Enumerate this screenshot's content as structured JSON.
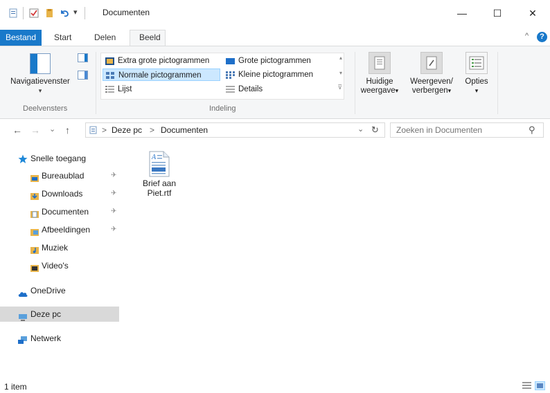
{
  "window": {
    "title": "Documenten",
    "minimize_glyph": "—",
    "maximize_glyph": "☐",
    "close_glyph": "✕",
    "qat_dropdown_glyph": "▾"
  },
  "ribbon": {
    "tabs": [
      "Bestand",
      "Start",
      "Delen",
      "Beeld"
    ],
    "active_tab": "Beeld",
    "collapse_glyph": "^",
    "help_glyph": "?",
    "panes_group": {
      "navigation_pane_label": "Navigatievenster",
      "group_label": "Deelvensters"
    },
    "layout_group": {
      "items": [
        "Extra grote pictogrammen",
        "Grote pictogrammen",
        "Normale pictogrammen",
        "Kleine pictogrammen",
        "Lijst",
        "Details"
      ],
      "selected": "Normale pictogrammen",
      "group_label": "Indeling"
    },
    "current_view": {
      "line1": "Huidige",
      "line2": "weergave"
    },
    "show_hide": {
      "line1": "Weergeven/",
      "line2": "verbergen"
    },
    "options": {
      "label": "Opties"
    },
    "dropdown_glyph": "▾"
  },
  "address": {
    "back_glyph": "←",
    "forward_glyph": "→",
    "recent_glyph": "⌄",
    "up_glyph": "↑",
    "separator_glyph": ">",
    "breadcrumbs": [
      "Deze pc",
      "Documenten"
    ],
    "dropdown_glyph": "⌄",
    "refresh_glyph": "↻",
    "search_placeholder": "Zoeken in Documenten",
    "search_glyph": "⚲"
  },
  "nav": {
    "pin_glyph": "✈",
    "quick_access": "Snelle toegang",
    "quick_items": [
      {
        "label": "Bureaublad",
        "pinned": true
      },
      {
        "label": "Downloads",
        "pinned": true
      },
      {
        "label": "Documenten",
        "pinned": true
      },
      {
        "label": "Afbeeldingen",
        "pinned": true
      },
      {
        "label": "Muziek",
        "pinned": false
      },
      {
        "label": "Video's",
        "pinned": false
      }
    ],
    "onedrive": "OneDrive",
    "this_pc": "Deze pc",
    "network": "Netwerk"
  },
  "files": [
    {
      "name_line1": "Brief aan",
      "name_line2": "Piet.rtf",
      "icon": "rtf-document-icon"
    }
  ],
  "status": {
    "item_count": "1 item"
  },
  "colors": {
    "accent": "#1979ca",
    "selection": "#cce8ff",
    "folder": "#e8b44a",
    "star": "#1e88d8"
  }
}
